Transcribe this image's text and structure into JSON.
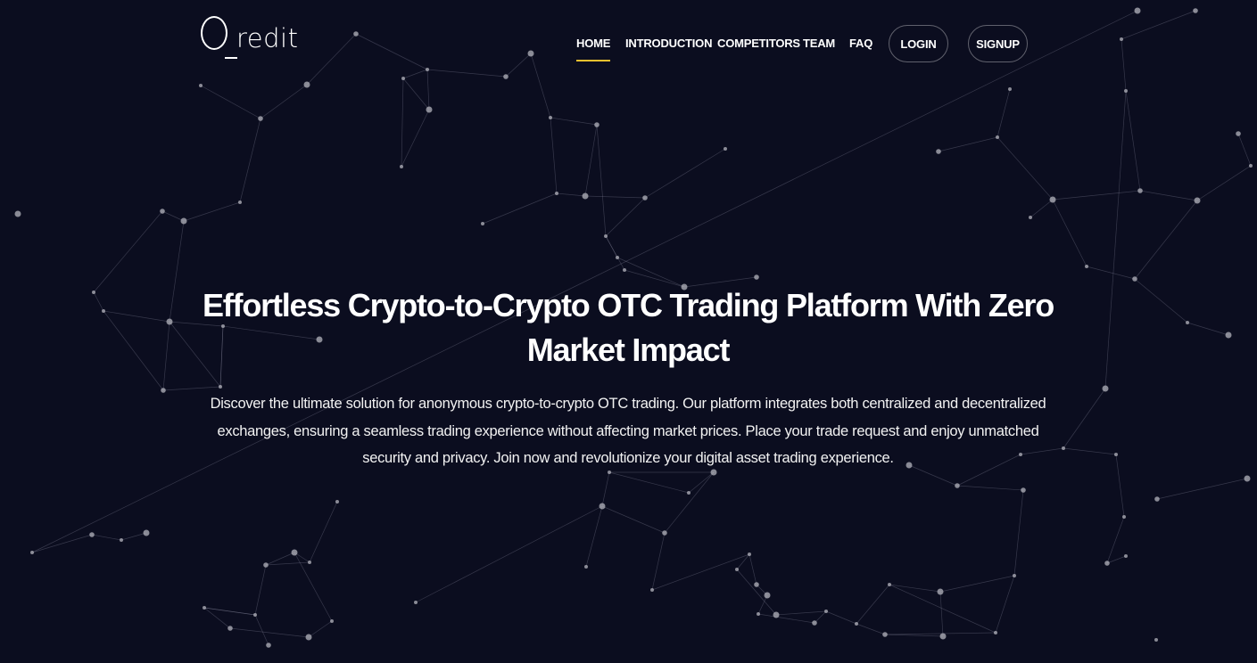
{
  "brand": {
    "logo_text": "redit"
  },
  "nav": {
    "items": [
      {
        "label": "HOME",
        "active": true
      },
      {
        "label": "INTRODUCTION",
        "active": false
      },
      {
        "label": "COMPETITORS",
        "active": false
      },
      {
        "label": "TEAM",
        "active": false
      },
      {
        "label": "FAQ",
        "active": false
      }
    ],
    "login_label": "LOGIN",
    "signup_label": "SIGNUP"
  },
  "hero": {
    "title": "Effortless Crypto-to-Crypto OTC Trading Platform With Zero Market Impact",
    "description": "Discover the ultimate solution for anonymous crypto-to-crypto OTC trading. Our platform integrates both centralized and decentralized exchanges, ensuring a seamless trading experience without affecting market prices. Place your trade request and enjoy unmatched security and privacy. Join now and revolutionize your digital asset trading experience."
  },
  "colors": {
    "background": "#0b0d1f",
    "accent": "#f2c12e",
    "text": "#ffffff"
  }
}
